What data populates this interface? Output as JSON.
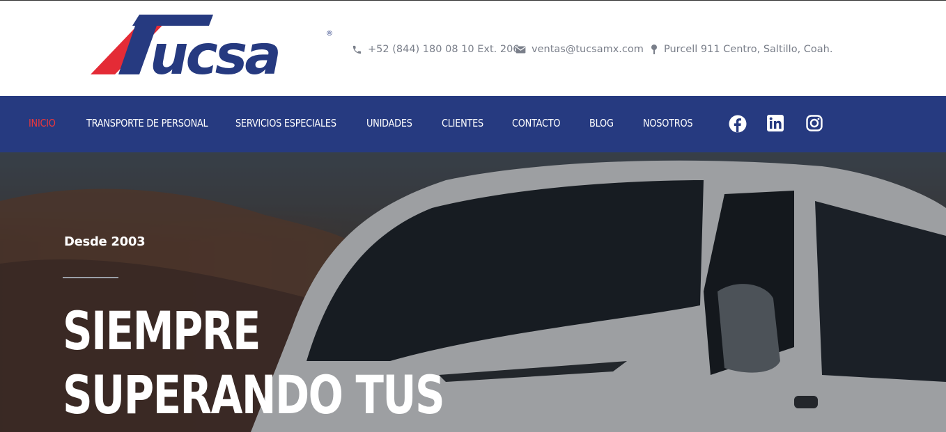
{
  "brand": {
    "name": "Tucsa",
    "registered": "®",
    "colors": {
      "red": "#e42b36",
      "blue": "#263a80"
    }
  },
  "header": {
    "contacts": [
      {
        "icon": "phone-icon",
        "text": "+52 (844) 180 08 10 Ext. 206"
      },
      {
        "icon": "mail-icon",
        "text": "ventas@tucsamx.com"
      },
      {
        "icon": "location-pin-icon",
        "text": "Purcell 911 Centro, Saltillo, Coah."
      }
    ]
  },
  "nav": {
    "items": [
      {
        "label": "INICIO",
        "active": true
      },
      {
        "label": "TRANSPORTE DE PERSONAL"
      },
      {
        "label": "SERVICIOS ESPECIALES"
      },
      {
        "label": "UNIDADES"
      },
      {
        "label": "CLIENTES"
      },
      {
        "label": "CONTACTO"
      },
      {
        "label": "BLOG"
      },
      {
        "label": "NOSOTROS"
      }
    ],
    "social": [
      "facebook-icon",
      "linkedin-icon",
      "instagram-icon"
    ],
    "active_color": "#e8373d"
  },
  "hero": {
    "eyebrow": "Desde 2003",
    "headline_line1": "SIEMPRE",
    "headline_line2": "SUPERANDO TUS"
  }
}
